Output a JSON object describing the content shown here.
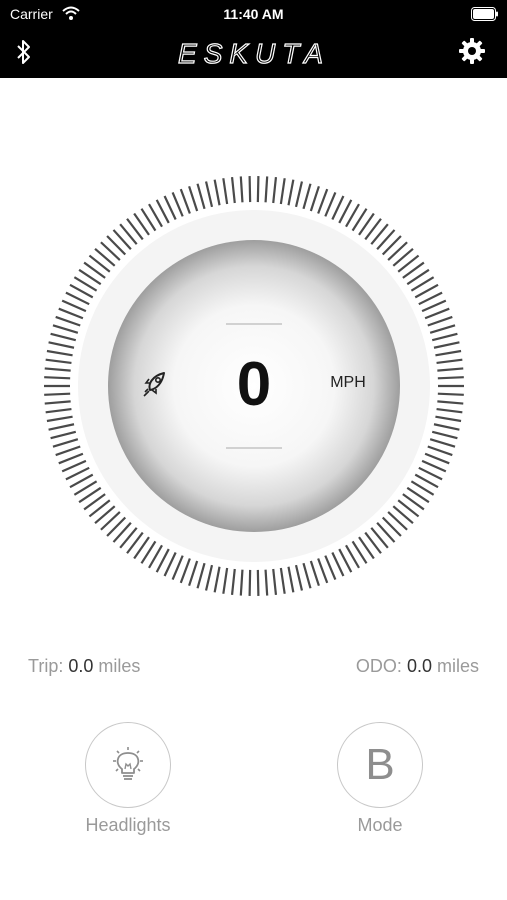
{
  "status_bar": {
    "carrier": "Carrier",
    "time": "11:40 AM"
  },
  "header": {
    "logo_text": "ESKUTA"
  },
  "gauge": {
    "speed": "0",
    "unit": "MPH",
    "mode_icon": "rocket-icon"
  },
  "stats": {
    "trip_label": "Trip:",
    "trip_value": "0.0",
    "trip_unit": "miles",
    "odo_label": "ODO:",
    "odo_value": "0.0",
    "odo_unit": "miles"
  },
  "controls": {
    "headlights_label": "Headlights",
    "mode_label": "Mode",
    "mode_value": "B"
  },
  "icons": [
    "wifi-icon",
    "battery-icon",
    "bluetooth-icon",
    "gear-icon",
    "lightbulb-icon",
    "rocket-icon"
  ]
}
